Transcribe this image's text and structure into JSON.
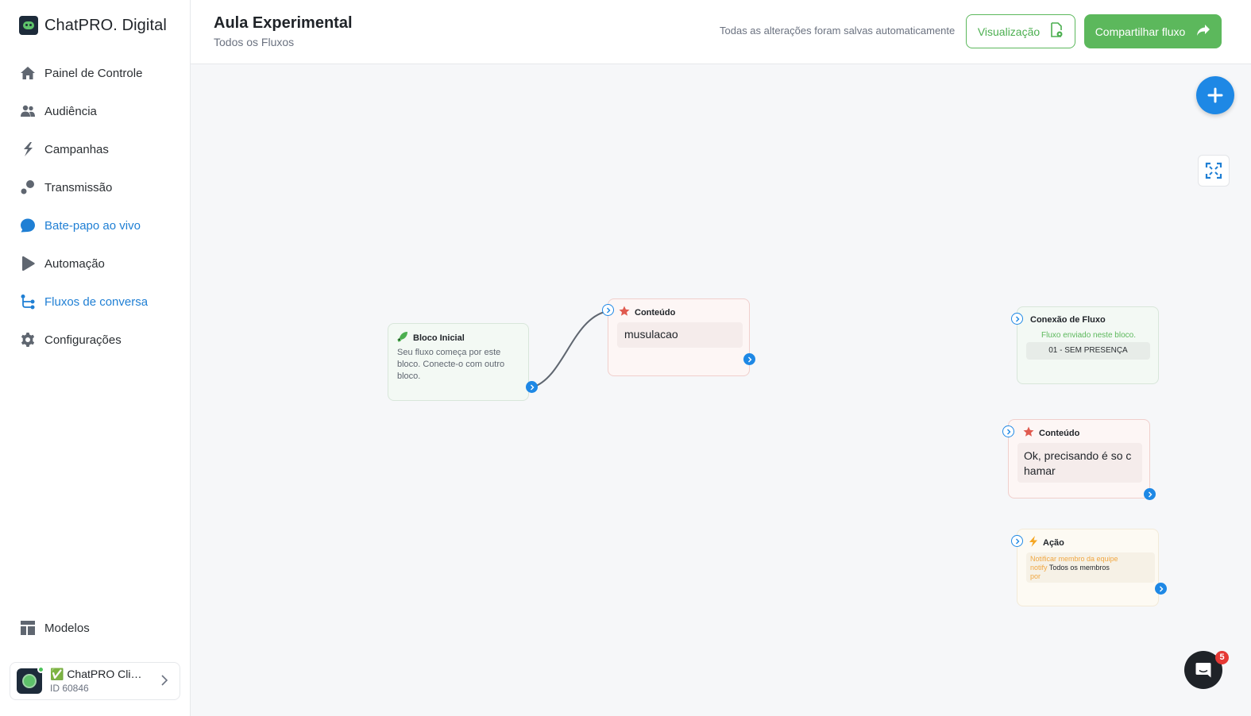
{
  "brand": {
    "name": "ChatPRO. Digital"
  },
  "nav": {
    "items": [
      {
        "label": "Painel de Controle"
      },
      {
        "label": "Audiência"
      },
      {
        "label": "Campanhas"
      },
      {
        "label": "Transmissão"
      },
      {
        "label": "Bate-papo ao vivo"
      },
      {
        "label": "Automação"
      },
      {
        "label": "Fluxos de conversa"
      },
      {
        "label": "Configurações"
      }
    ],
    "bottom": {
      "label": "Modelos"
    }
  },
  "account": {
    "name": "✅ ChatPRO Clie...",
    "id": "ID 60846"
  },
  "header": {
    "title": "Aula Experimental",
    "breadcrumb": "Todos os Fluxos",
    "saved_status": "Todas as alterações foram salvas automaticamente",
    "preview_label": "Visualização",
    "share_label": "Compartilhar fluxo"
  },
  "nodes": {
    "start": {
      "title": "Bloco Inicial",
      "description": "Seu fluxo começa por este bloco. Conecte-o com outro bloco."
    },
    "content1": {
      "title": "Conteúdo",
      "message": "musulacao"
    },
    "flow": {
      "title": "Conexão de Fluxo",
      "subtitle": "Fluxo enviado neste bloco.",
      "target": "01 - SEM PRESENÇA"
    },
    "content2": {
      "title": "Conteúdo",
      "message": "Ok, precisando é so chamar"
    },
    "action": {
      "title": "Ação",
      "line1": "Notificar membro da equipe",
      "notify_key": "notify",
      "notify_value": "Todos os membros",
      "line3": "por"
    }
  },
  "chat": {
    "badge": "5"
  },
  "colors": {
    "accent": "#1e88e5",
    "success": "#5cb85c",
    "active_nav": "#1f7fd4",
    "danger": "#e53935"
  }
}
